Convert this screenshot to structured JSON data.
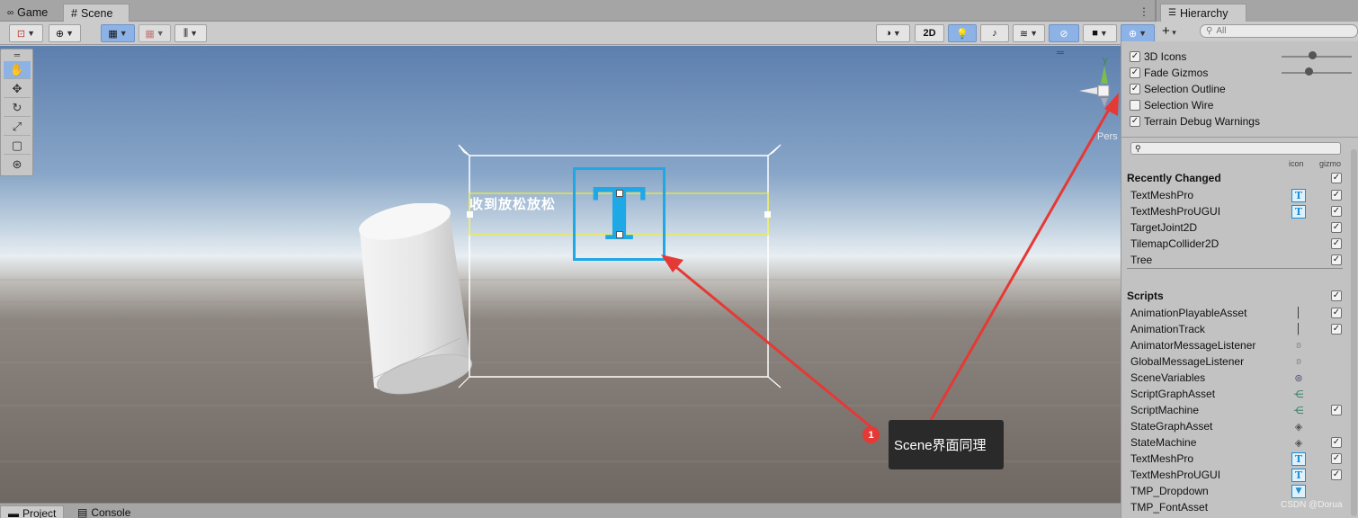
{
  "tabs": {
    "game": "Game",
    "scene": "Scene",
    "hierarchy": "Hierarchy"
  },
  "toolbar": {
    "mode_2d": "2D"
  },
  "hierarchy": {
    "search_placeholder": "All"
  },
  "viewport": {
    "text_label": "收到放松放松",
    "t_glyph": "T",
    "axis_y": "y",
    "persp_label": "Pers"
  },
  "gizmos": {
    "options": [
      {
        "label": "3D Icons",
        "checked": true
      },
      {
        "label": "Fade Gizmos",
        "checked": true
      },
      {
        "label": "Selection Outline",
        "checked": true
      },
      {
        "label": "Selection Wire",
        "checked": false
      },
      {
        "label": "Terrain Debug Warnings",
        "checked": true
      }
    ],
    "col_icon": "icon",
    "col_gizmo": "gizmo",
    "recently_changed": {
      "title": "Recently Changed",
      "items": [
        {
          "name": "TextMeshPro",
          "icon": "T",
          "gizmo": true
        },
        {
          "name": "TextMeshProUGUI",
          "icon": "T",
          "gizmo": true
        },
        {
          "name": "TargetJoint2D",
          "icon": "",
          "gizmo": true
        },
        {
          "name": "TilemapCollider2D",
          "icon": "",
          "gizmo": true
        },
        {
          "name": "Tree",
          "icon": "",
          "gizmo": true
        }
      ]
    },
    "scripts": {
      "title": "Scripts",
      "items": [
        {
          "name": "AnimationPlayableAsset",
          "icon": "|",
          "gizmo": true
        },
        {
          "name": "AnimationTrack",
          "icon": "|",
          "gizmo": true
        },
        {
          "name": "AnimatorMessageListener",
          "icon": "ear",
          "gizmo": false
        },
        {
          "name": "GlobalMessageListener",
          "icon": "ear",
          "gizmo": false
        },
        {
          "name": "SceneVariables",
          "icon": "globe",
          "gizmo": false
        },
        {
          "name": "ScriptGraphAsset",
          "icon": "graph",
          "gizmo": false
        },
        {
          "name": "ScriptMachine",
          "icon": "graph",
          "gizmo": true
        },
        {
          "name": "StateGraphAsset",
          "icon": "state",
          "gizmo": false
        },
        {
          "name": "StateMachine",
          "icon": "state",
          "gizmo": true
        },
        {
          "name": "TextMeshPro",
          "icon": "T",
          "gizmo": true
        },
        {
          "name": "TextMeshProUGUI",
          "icon": "T",
          "gizmo": true
        },
        {
          "name": "TMP_Dropdown",
          "icon": "dropdown",
          "gizmo": false
        },
        {
          "name": "TMP_FontAsset",
          "icon": "",
          "gizmo": false
        }
      ]
    }
  },
  "bottom_tabs": {
    "project": "Project",
    "console": "Console"
  },
  "callout": {
    "number": "1",
    "text": "Scene界面同理"
  },
  "watermark": "CSDN @Dorua",
  "colors": {
    "selection_blue": "#8db3e6",
    "tmp_icon_blue": "#1ea8e6",
    "arrow_red": "#e53935"
  }
}
